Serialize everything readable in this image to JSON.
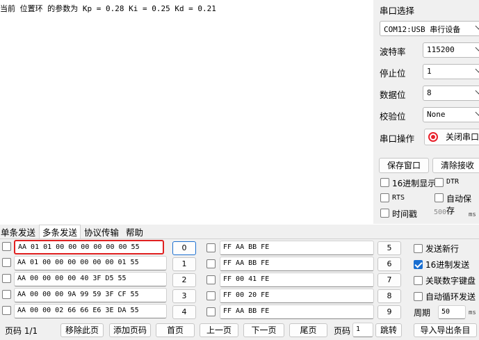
{
  "receive": {
    "text": "当前 位置环 的参数为 Kp = 0.28 Ki = 0.25 Kd = 0.21"
  },
  "port_panel": {
    "title": "串口选择",
    "port_value": "COM12:USB 串行设备",
    "baud_label": "波特率",
    "baud_value": "115200",
    "stop_label": "停止位",
    "stop_value": "1",
    "data_label": "数据位",
    "data_value": "8",
    "parity_label": "校验位",
    "parity_value": "None",
    "op_label": "串口操作",
    "close_port_label": "关闭串口",
    "save_window_label": "保存窗口",
    "clear_recv_label": "清除接收",
    "hex_display_label": "16进制显示",
    "dtr_label": "DTR",
    "rts_label": "RTS",
    "auto_save_label": "自动保存",
    "timestamp_label": "时间戳",
    "timestamp_value": "500",
    "timestamp_unit": "ms",
    "status_red": "#e8202a"
  },
  "tabs": [
    "单条发送",
    "多条发送",
    "协议传输",
    "帮助"
  ],
  "multi_send": {
    "left_rows": [
      {
        "data": "AA 01 01 00 00 00 00 00 00 55",
        "num": "0"
      },
      {
        "data": "AA 01 00 00 00 00 00 00 01 55",
        "num": "1"
      },
      {
        "data": "AA 00 00 00 00 40 3F D5 55",
        "num": "2"
      },
      {
        "data": "AA 00 00 00 9A 99 59 3F CF 55",
        "num": "3"
      },
      {
        "data": "AA 00 00 02 66 66 E6 3E DA 55",
        "num": "4"
      }
    ],
    "right_rows": [
      {
        "data": "FF AA BB FE",
        "num": "5"
      },
      {
        "data": "FF AA BB FE",
        "num": "6"
      },
      {
        "data": "FF 00 41 FE",
        "num": "7"
      },
      {
        "data": "FF 00 20 FE",
        "num": "8"
      },
      {
        "data": "FF AA BB FE",
        "num": "9"
      }
    ],
    "options": {
      "send_newline": "发送新行",
      "hex_send": "16进制发送",
      "keypad": "关联数字键盘",
      "auto_loop": "自动循环发送",
      "period_label": "周期",
      "period_value": "50",
      "period_unit": "ms"
    },
    "highlight_color": "#e02020",
    "accent": "#1a6fd1"
  },
  "bottom_bar": {
    "page_info": "页码 1/1",
    "remove_page": "移除此页",
    "add_page": "添加页码",
    "first_page": "首页",
    "prev_page": "上一页",
    "next_page": "下一页",
    "last_page": "尾页",
    "page_label": "页码",
    "page_input": "1",
    "jump": "跳转",
    "import_export": "导入导出条目"
  }
}
